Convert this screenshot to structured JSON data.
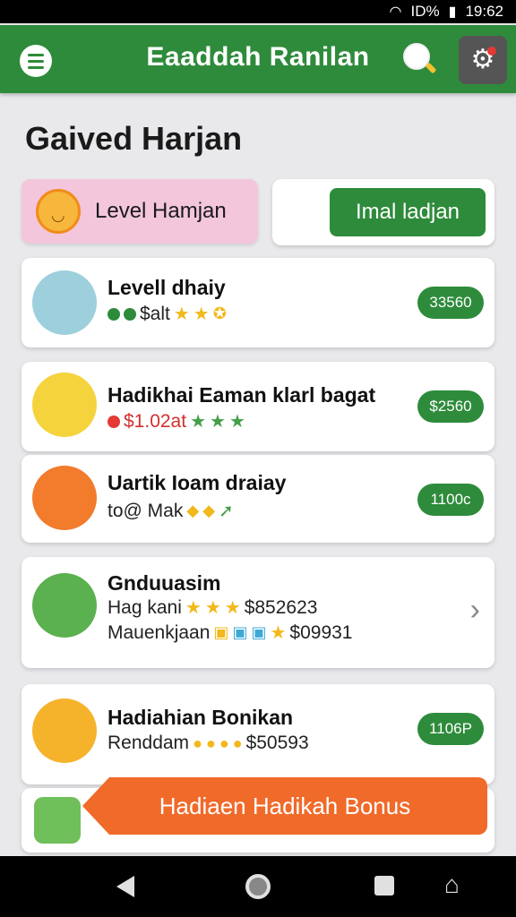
{
  "status_bar": {
    "signal": "ID%",
    "time": "19:62"
  },
  "app_bar": {
    "title": "Eaaddah Ranilan"
  },
  "page": {
    "title": "Gaived Harjan"
  },
  "level_box": {
    "label": "Level Hamjan"
  },
  "action": {
    "label": "Imal ladjan"
  },
  "cards": [
    {
      "title": "Levell dhaiy",
      "sub": "$alt",
      "price": "33560"
    },
    {
      "title": "Hadikhai Eaman klarl bagat",
      "sub": "$1.02at",
      "price": "$2560"
    },
    {
      "title": "Uartik Ioam draiay",
      "sub": "to@ Mak",
      "price": "1100c"
    },
    {
      "title": "Gnduuasim",
      "line1": "Hag kani",
      "line1_value": "$852623",
      "line2": "Mauenkjaan",
      "line2_value": "$09931"
    },
    {
      "title": "Hadiahian Bonikan",
      "sub": "Renddam",
      "sub_value": "$50593",
      "price": "1106P"
    }
  ],
  "bonus": {
    "label": "Hadiaen Hadikah Bonus"
  },
  "colors": {
    "primary": "#2e8b3b",
    "accent": "#f06a2a",
    "level_bg": "#f3c6dc"
  }
}
